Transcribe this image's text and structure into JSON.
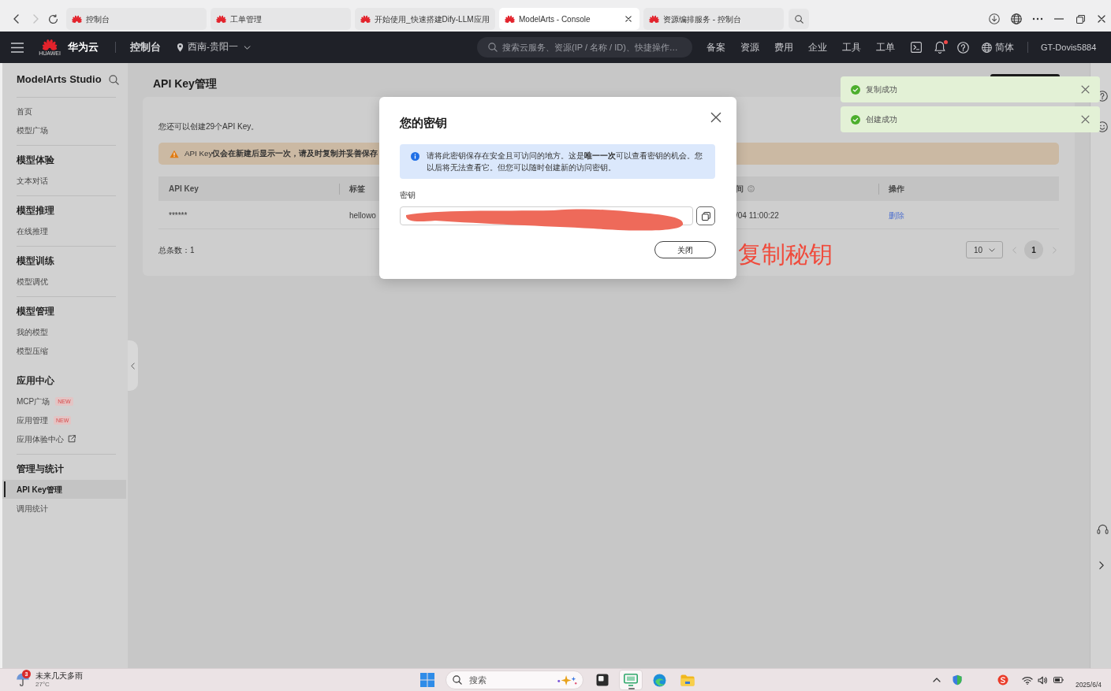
{
  "browser": {
    "forward_disabled": true,
    "tabs": [
      {
        "title": "控制台",
        "selected": false
      },
      {
        "title": "工单管理",
        "selected": false
      },
      {
        "title": "开始使用_快速搭建Dify-LLM应用",
        "selected": false
      },
      {
        "title": "ModelArts - Console",
        "selected": true
      },
      {
        "title": "资源编排服务 - 控制台",
        "selected": false
      }
    ]
  },
  "top_nav": {
    "brand": "华为云",
    "logo_text": "HUAWEI",
    "console": "控制台",
    "region": "西南-贵阳一",
    "search": {
      "placeholder": "搜索云服务、资源(IP / 名称 / ID)、快捷操作…"
    },
    "links": [
      "备案",
      "资源",
      "费用",
      "企业",
      "工具",
      "工单"
    ],
    "notification_dot": true,
    "language": "简体",
    "user": "GT-Dovis5884"
  },
  "sidebar": {
    "title": "ModelArts Studio",
    "groups": [
      {
        "items": [
          {
            "label": "首页",
            "selected": false
          },
          {
            "label": "模型广场",
            "selected": false
          }
        ],
        "divider_after": true
      },
      {
        "heading": "模型体验",
        "items": [
          {
            "label": "文本对话",
            "selected": false
          }
        ],
        "divider_after": true
      },
      {
        "heading": "模型推理",
        "items": [
          {
            "label": "在线推理",
            "selected": false
          }
        ],
        "divider_after": true
      },
      {
        "heading": "模型训练",
        "items": [
          {
            "label": "模型调优",
            "selected": false
          }
        ],
        "divider_after": true
      },
      {
        "heading": "模型管理",
        "items": [
          {
            "label": "我的模型",
            "selected": false
          },
          {
            "label": "模型压缩",
            "selected": false
          }
        ],
        "divider_after": false
      },
      {
        "heading": "应用中心",
        "items": [
          {
            "label": "MCP广场",
            "badge": "NEW",
            "selected": false
          },
          {
            "label": "应用管理",
            "badge": "NEW",
            "selected": false
          },
          {
            "label": "应用体验中心",
            "external": true,
            "selected": false
          }
        ],
        "divider_after": true
      },
      {
        "heading": "管理与统计",
        "items": [
          {
            "label": "API Key管理",
            "selected": true
          },
          {
            "label": "调用统计",
            "selected": false
          }
        ],
        "divider_after": false
      }
    ]
  },
  "page": {
    "title": "API Key管理",
    "quota_note": "您还可以创建29个API Key。",
    "warning": "API Key**仅会在新建后显示一次，请及时复制并妥善保存**",
    "table": {
      "columns": [
        {
          "label": "API Key"
        },
        {
          "label": "标签"
        },
        {
          "label": "间",
          "sortable": true
        },
        {
          "label": "操作"
        }
      ],
      "rows": [
        {
          "cells": [
            "******",
            "hellowo",
            "/04 11:00:22"
          ],
          "action": "删除"
        }
      ]
    },
    "total": "总条数：1",
    "pagination": {
      "page_size": "10",
      "pages": [
        {
          "label": "1",
          "selected": true
        }
      ]
    }
  },
  "modal": {
    "title": "您的密钥",
    "notice": "请将此密钥保存在安全且可访问的地方。这是**唯一一次**可以查看密钥的机会。您以后将无法查看它。但您可以随时创建新的访问密钥。",
    "field_label": "密钥",
    "button": "关闭"
  },
  "annotation": "复制秘钥",
  "toasts": [
    {
      "message": "复制成功"
    },
    {
      "message": "创建成功"
    }
  ],
  "taskbar": {
    "weather": {
      "badge": "3",
      "summary": "未来几天多雨",
      "temperature": "27°C"
    },
    "search": {
      "placeholder": "搜索"
    },
    "apps": [
      {
        "kind": "tiles",
        "selected": false
      },
      {
        "kind": "screen",
        "selected": true
      },
      {
        "kind": "browser",
        "selected": false
      },
      {
        "kind": "folder",
        "selected": false
      }
    ],
    "date": "2025/6/4"
  }
}
